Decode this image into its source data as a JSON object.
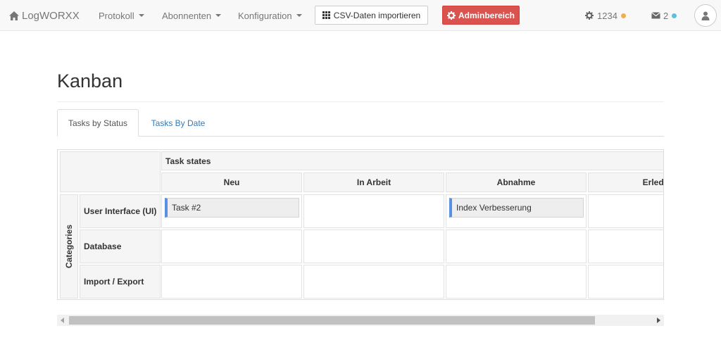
{
  "navbar": {
    "brand": "LogWORXX",
    "menus": [
      {
        "label": "Protokoll"
      },
      {
        "label": "Abonnenten"
      },
      {
        "label": "Konfiguration"
      }
    ],
    "csv_button": "CSV-Daten importieren",
    "admin_button": "Adminbereich",
    "settings_count": "1234",
    "mail_count": "2",
    "colors": {
      "admin": "#d9534f",
      "settings_dot": "#f0ad4e",
      "mail_dot": "#5bc0de"
    },
    "icons": {
      "home": "home-icon",
      "grid": "grid-icon",
      "gear": "gear-icon",
      "envelope": "envelope-icon",
      "user": "user-icon"
    }
  },
  "page": {
    "title": "Kanban",
    "tabs": [
      {
        "label": "Tasks by Status",
        "active": true
      },
      {
        "label": "Tasks By Date",
        "active": false
      }
    ]
  },
  "kanban": {
    "group_header": "Task states",
    "columns": [
      "Neu",
      "In Arbeit",
      "Abnahme",
      "Erledigt"
    ],
    "categories_label": "Categories",
    "rows": [
      "User Interface (UI)",
      "Database",
      "Import / Export"
    ],
    "cards": [
      {
        "label": "Task #2",
        "row": 0,
        "column": 0
      },
      {
        "label": "Index Verbesserung",
        "row": 0,
        "column": 2
      }
    ],
    "card_accent": "#5b8ee6"
  }
}
